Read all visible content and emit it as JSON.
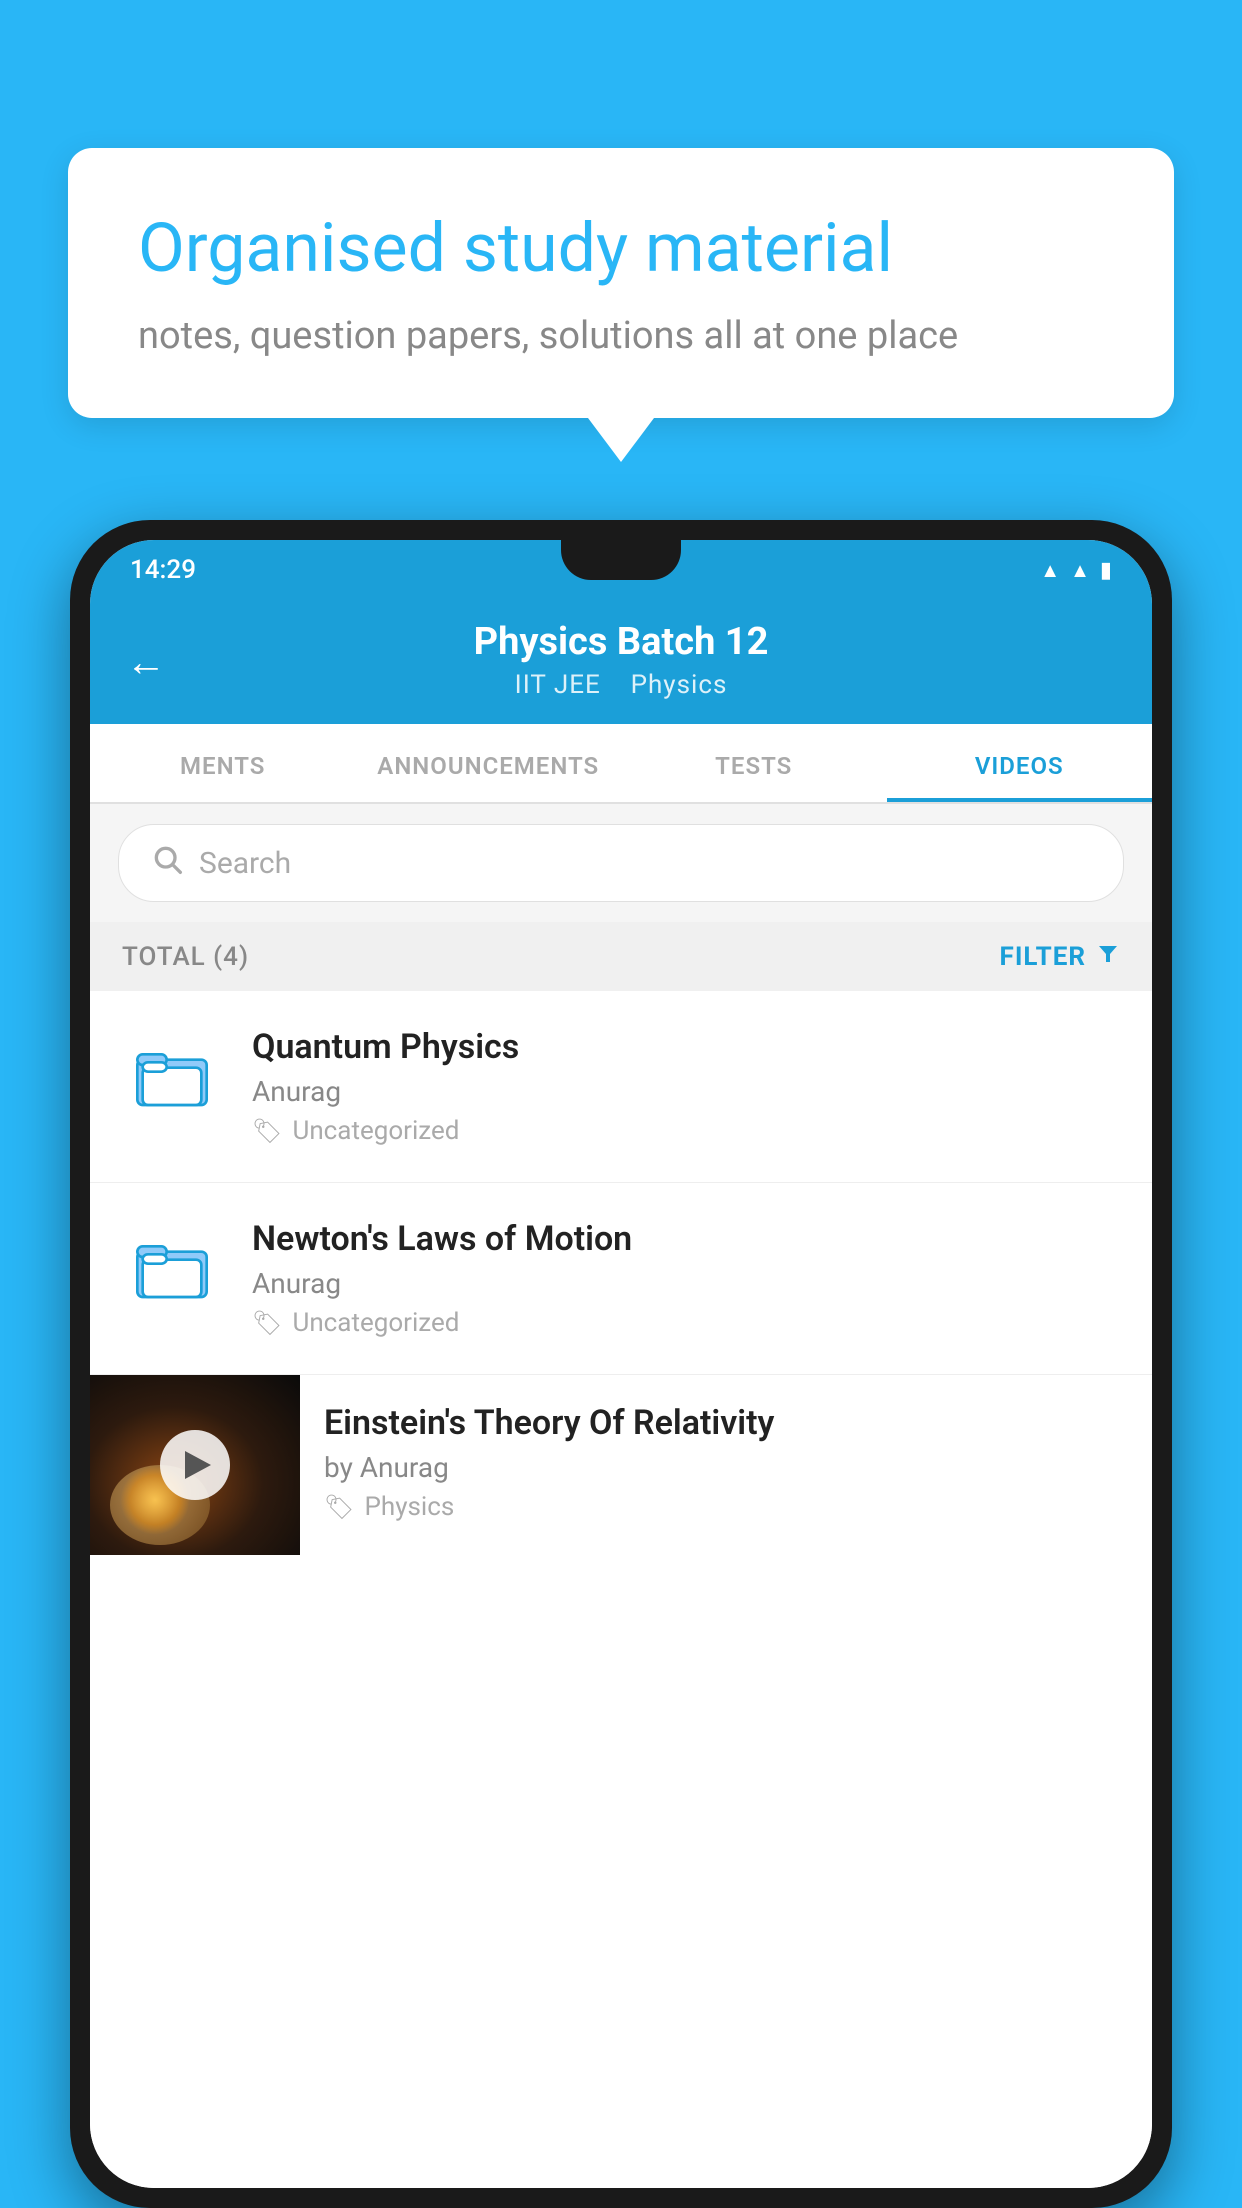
{
  "background_color": "#29B6F6",
  "bubble": {
    "title": "Organised study material",
    "subtitle": "notes, question papers, solutions all at one place"
  },
  "phone": {
    "status_bar": {
      "time": "14:29",
      "wifi": "wifi",
      "signal": "signal",
      "battery": "battery"
    },
    "header": {
      "back_label": "←",
      "title": "Physics Batch 12",
      "subtitle_part1": "IIT JEE",
      "subtitle_part2": "Physics"
    },
    "tabs": [
      {
        "label": "MENTS",
        "active": false
      },
      {
        "label": "ANNOUNCEMENTS",
        "active": false
      },
      {
        "label": "TESTS",
        "active": false
      },
      {
        "label": "VIDEOS",
        "active": true
      }
    ],
    "search": {
      "placeholder": "Search"
    },
    "filter_bar": {
      "total_label": "TOTAL (4)",
      "filter_label": "FILTER"
    },
    "videos": [
      {
        "title": "Quantum Physics",
        "author": "Anurag",
        "tag": "Uncategorized",
        "has_thumbnail": false
      },
      {
        "title": "Newton's Laws of Motion",
        "author": "Anurag",
        "tag": "Uncategorized",
        "has_thumbnail": false
      },
      {
        "title": "Einstein's Theory Of Relativity",
        "author": "by Anurag",
        "tag": "Physics",
        "has_thumbnail": true
      }
    ]
  }
}
